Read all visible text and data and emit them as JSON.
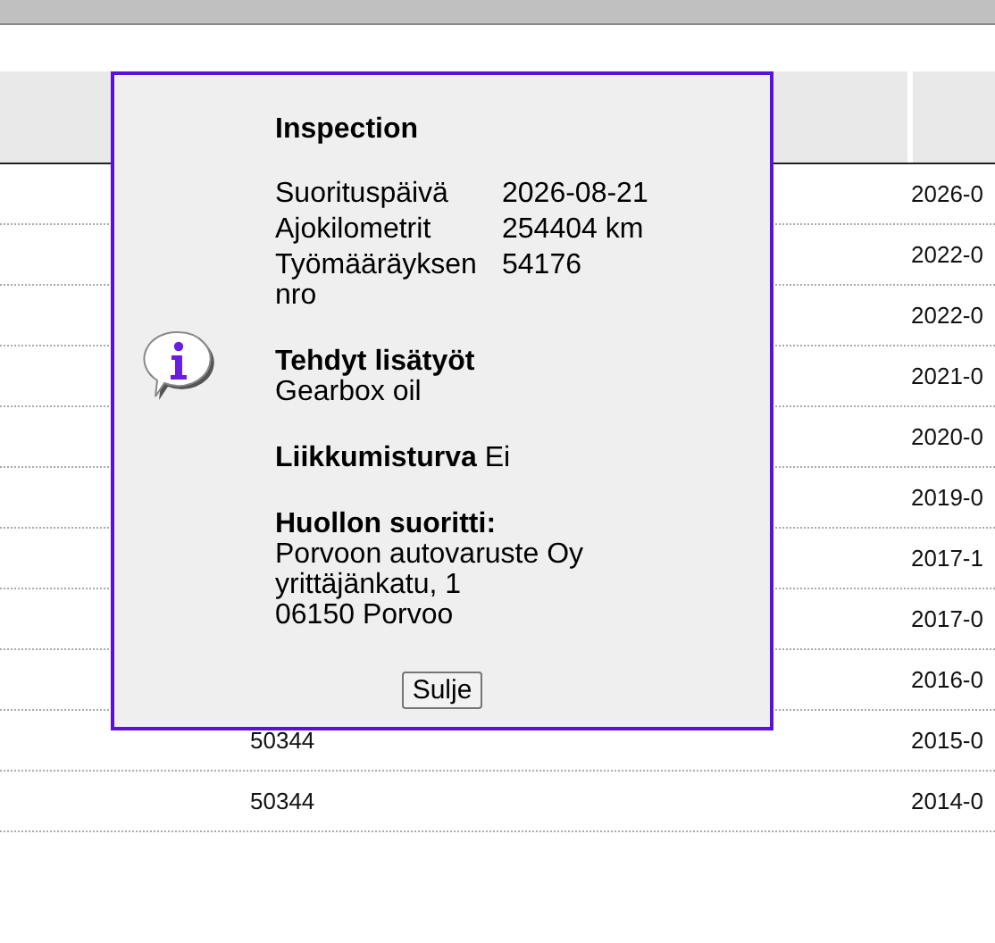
{
  "dialog": {
    "title": "Inspection",
    "fields": [
      {
        "label": "Suorituspäivä",
        "value": "2026-08-21"
      },
      {
        "label": "Ajokilometrit",
        "value": "254404 km"
      },
      {
        "label": "Työmääräyksen nro",
        "value": "54176"
      }
    ],
    "sections": [
      {
        "kind": "block",
        "label": "Tehdyt lisätyöt",
        "lines": [
          "Gearbox oil"
        ]
      },
      {
        "kind": "inline",
        "label": "Liikkumisturva",
        "value": "Ei"
      },
      {
        "kind": "block",
        "label": "Huollon suoritti:",
        "lines": [
          "Porvoon autovaruste Oy",
          "yrittäjänkatu, 1",
          "06150 Porvoo"
        ]
      }
    ],
    "button": "Sulje"
  },
  "table": {
    "rows": [
      {
        "date": "2026-0"
      },
      {
        "date": "2022-0"
      },
      {
        "date": "2022-0"
      },
      {
        "date": "2021-0"
      },
      {
        "date": "2020-0"
      },
      {
        "date": "2019-0"
      },
      {
        "date": "2017-1"
      },
      {
        "date": "2017-0"
      },
      {
        "date": "2016-0"
      },
      {
        "column_2": "50344",
        "date": "2015-0"
      },
      {
        "column_2": "50344",
        "date": "2014-0"
      }
    ]
  }
}
